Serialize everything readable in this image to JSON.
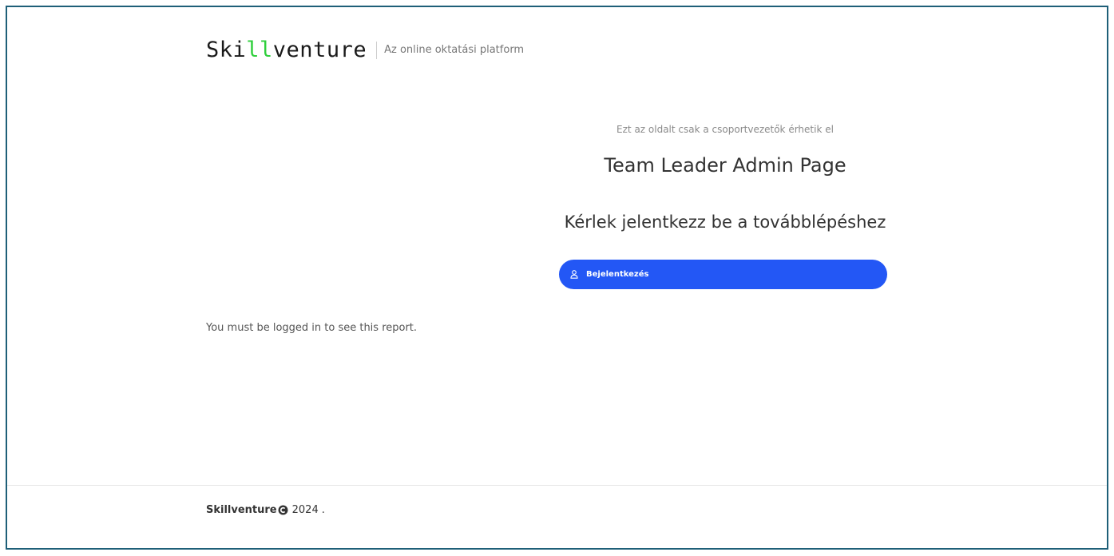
{
  "header": {
    "logo": {
      "prefix": "Ski",
      "highlight": "ll",
      "suffix": "venture"
    },
    "tagline": "Az online oktatási platform"
  },
  "main": {
    "restricted_note": "Ezt az oldalt csak a csoportvezetők érhetik el",
    "title": "Team Leader Admin Page",
    "login_prompt": "Kérlek jelentkezz be a továbblépéshez",
    "login_button": {
      "icon": "user-icon",
      "label": "Bejelentkezés"
    },
    "report_message": "You must be logged in to see this report."
  },
  "footer": {
    "brand": "Skillventure",
    "copyright_icon": "copyright-icon",
    "year": "2024",
    "trailing": "."
  },
  "colors": {
    "accent": "#2357f5",
    "logo_highlight": "#2fcf3c",
    "frame_border": "#1e5f78"
  }
}
